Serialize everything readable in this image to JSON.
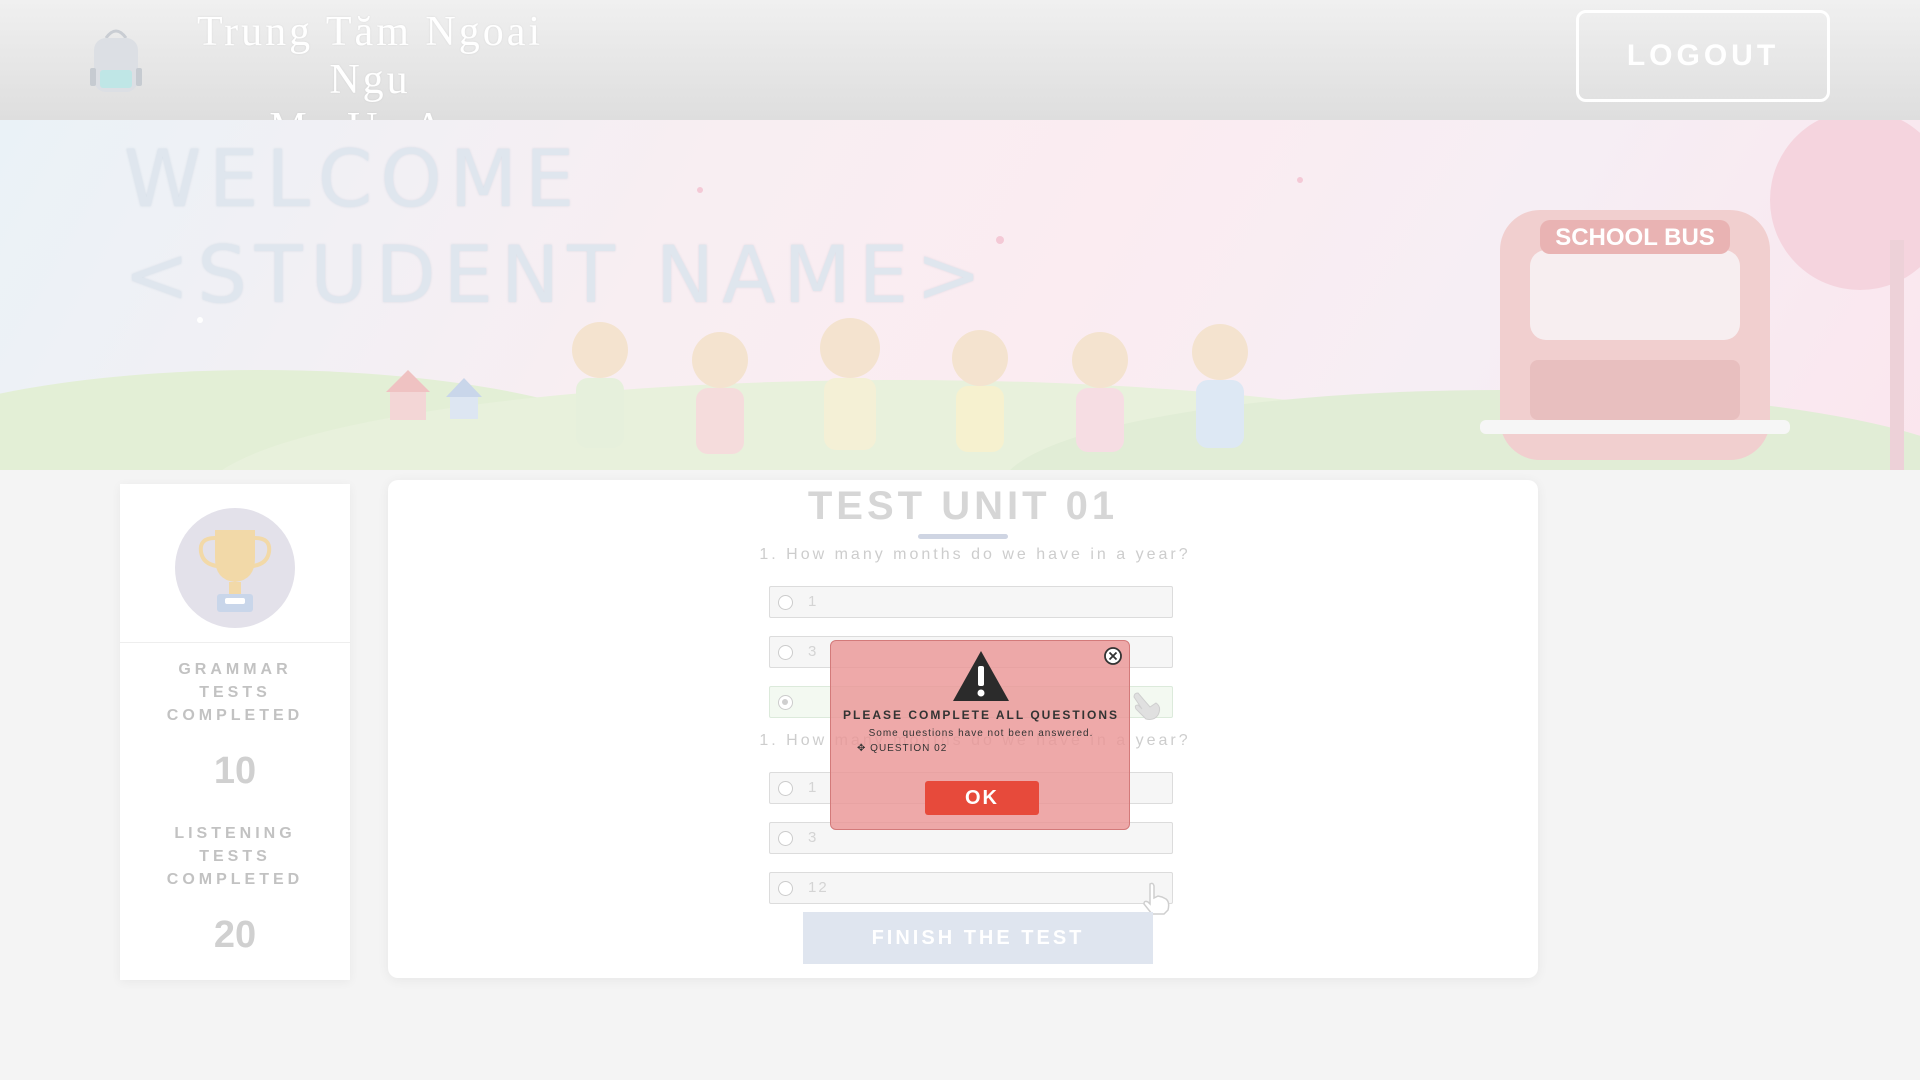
{
  "header": {
    "brand_line1": "Trung Tăm Ngoai Ngu",
    "brand_line2": "My Uc Au",
    "logout_label": "LOGOUT",
    "logo_icon": "backpack-icon"
  },
  "banner": {
    "welcome_line1": "WELCOME",
    "welcome_line2": "<STUDENT NAME>",
    "bus_sign": "SCHOOL BUS"
  },
  "sidebar": {
    "avatar_icon": "trophy-icon",
    "stats": [
      {
        "label_lines": [
          "GRAMMAR",
          "TESTS",
          "COMPLETED"
        ],
        "value": "10"
      },
      {
        "label_lines": [
          "LISTENING",
          "TESTS",
          "COMPLETED"
        ],
        "value": "20"
      }
    ]
  },
  "test": {
    "title": "TEST UNIT 01",
    "questions": [
      {
        "text": "1. How many months do we have in a year?",
        "options": [
          {
            "text": "1",
            "selected": false
          },
          {
            "text": "3",
            "selected": false
          },
          {
            "text": "",
            "selected": true
          }
        ]
      },
      {
        "text": "1. How many months do we have in a year?",
        "options": [
          {
            "text": "1",
            "selected": false
          },
          {
            "text": "3",
            "selected": false
          },
          {
            "text": "12",
            "selected": false
          }
        ]
      }
    ],
    "finish_label": "FINISH THE TEST"
  },
  "modal": {
    "icon": "warning-icon",
    "close_icon": "close-circle-icon",
    "title": "PLEASE COMPLETE ALL QUESTIONS",
    "message": "Some questions have not been answered.",
    "items": [
      "QUESTION 02"
    ],
    "ok_label": "OK"
  },
  "colors": {
    "ok_button": "#e74a3b",
    "modal_bg": "#ea9696",
    "finish_button": "#dfe5ef"
  }
}
